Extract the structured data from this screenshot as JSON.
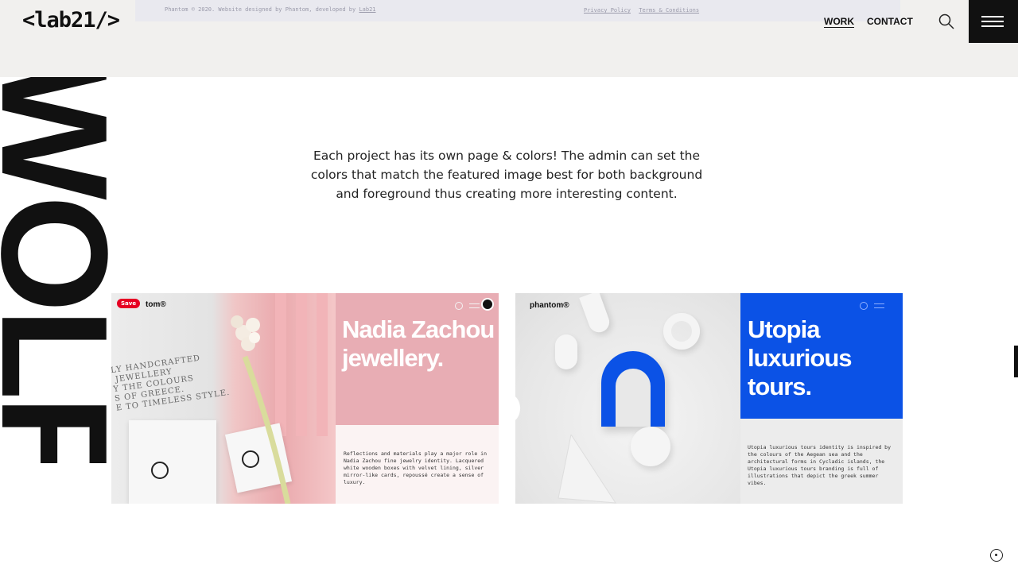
{
  "footer": {
    "copyright": "Phantom © 2020. Website designed by Phantom, developed by",
    "developer_link": "Lab21",
    "privacy": "Privacy Policy",
    "terms": "Terms & Conditions"
  },
  "header": {
    "logo": "<lab21/>",
    "nav": [
      {
        "label": "WORK",
        "active": true
      },
      {
        "label": "CONTACT",
        "active": false
      }
    ],
    "search_icon": "search-icon",
    "menu_icon": "hamburger-icon"
  },
  "hero": {
    "big_word": "WOLF"
  },
  "intro": {
    "text": "Each project has its own page & colors! The admin can set the colors that match the featured image best for both background and foreground thus creating more interesting content."
  },
  "projects": [
    {
      "brand": "tom®",
      "save_label": "Save",
      "title": "Nadia Zachou jewellery.",
      "image_text": "LY HANDCRAFTED\n JEWELLERY\nY THE COLOURS\nS OF GREECE.\nE TO TIMELESS STYLE.",
      "description": "Reflections and materials play a major role in Nadia Zachou fine jewelry identity. Lacquered white wooden boxes with velvet lining, silver mirror-like cards, repoussé create a sense of luxury.",
      "accent": "#e8adb4"
    },
    {
      "brand": "phantom®",
      "title": "Utopia luxurious tours.",
      "description": "Utopia luxurious tours identity is inspired by the colours of the Aegean sea and the architectural forms in Cycladic islands, the Utopia luxurious tours branding is full of illustrations that depict the greek summer vibes.",
      "accent": "#0b52e6"
    }
  ]
}
